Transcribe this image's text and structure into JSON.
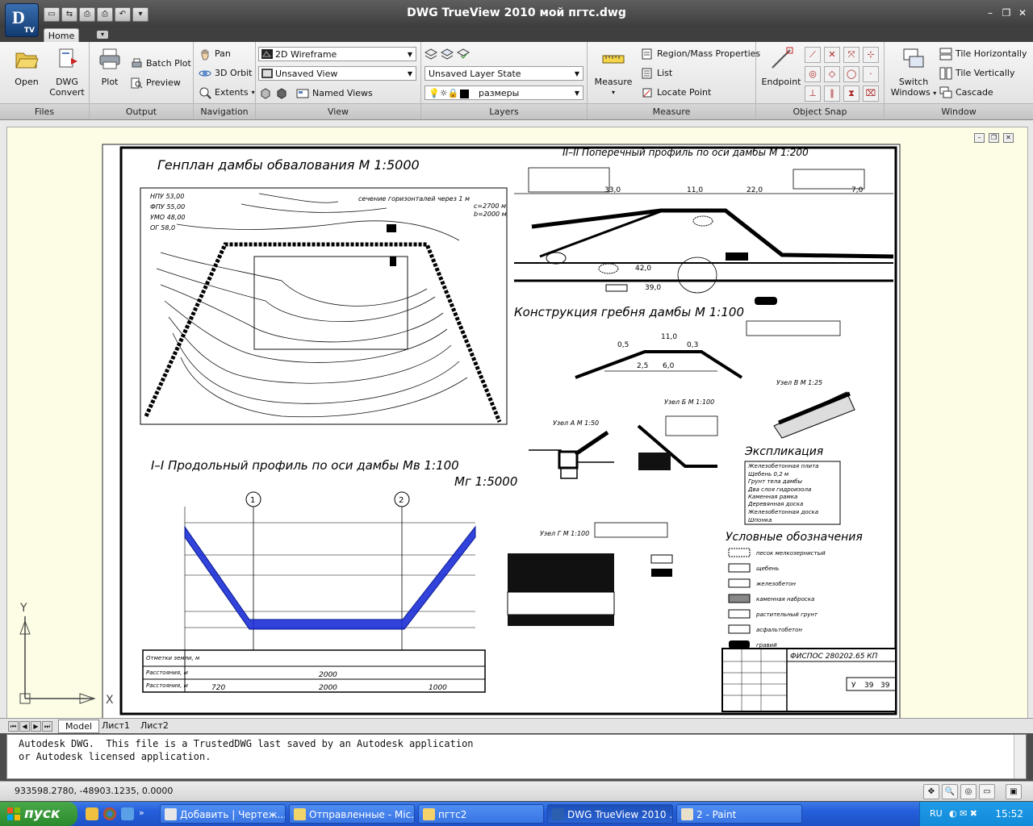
{
  "window": {
    "title": "DWG TrueView 2010    мой пгтс.dwg",
    "app_badge": "TV",
    "controls": [
      "minimize-icon",
      "restore-icon",
      "close-icon"
    ]
  },
  "ribbon": {
    "active_tab": "Home",
    "panels": {
      "files": {
        "title": "Files",
        "open": "Open",
        "dwg_convert_1": "DWG",
        "dwg_convert_2": "Convert"
      },
      "output": {
        "title": "Output",
        "plot": "Plot",
        "batch_plot": "Batch Plot",
        "preview": "Preview"
      },
      "navigation": {
        "title": "Navigation",
        "pan": "Pan",
        "orbit": "3D Orbit",
        "extents": "Extents"
      },
      "view": {
        "title": "View",
        "visual_style": "2D Wireframe",
        "saved_view": "Unsaved View",
        "named_views": "Named Views"
      },
      "layers": {
        "title": "Layers",
        "layer_state": "Unsaved Layer State",
        "current_layer": "размеры"
      },
      "measure": {
        "title": "Measure",
        "measure": "Measure",
        "region_mass": "Region/Mass Properties",
        "list": "List",
        "locate_point": "Locate Point"
      },
      "object_snap": {
        "title": "Object Snap",
        "endpoint": "Endpoint"
      },
      "window_panel": {
        "title": "Window",
        "switch_1": "Switch",
        "switch_2": "Windows",
        "tile_h": "Tile Horizontally",
        "tile_v": "Tile Vertically",
        "cascade": "Cascade"
      }
    }
  },
  "drawing": {
    "titles": {
      "genplan": "Генплан дамбы обвалования М 1:5000",
      "cross_profile": "II–II Поперечный профиль по оси дамбы М 1:200",
      "crest": "Конструкция гребня дамбы М 1:100",
      "long_profile_1": "I–I Продольный профиль по оси дамбы Мв 1:100",
      "long_profile_2": "Мг 1:5000",
      "explication": "Экспликация",
      "legend": "Условные обозначения",
      "node_a": "Узел А М 1:50",
      "node_b": "Узел Б М 1:100",
      "node_v": "Узел В М 1:25",
      "node_g": "Узел Г М 1:100"
    },
    "levels": [
      "НПУ 53,00",
      "ФПУ 55,00",
      "УМО 48,00",
      "ОГ 58,0"
    ],
    "contour_note_1": "сечение горизонталей через 1 м",
    "contour_note_2": "c=2700 м",
    "contour_note_3": "b=2000 м",
    "dims": {
      "d1": "33,0",
      "d2": "11,0",
      "d3": "22,0",
      "d4": "7,0",
      "d5": "42,0",
      "d6": "39,0",
      "d7": "11,0",
      "d8": "6,0",
      "d9": "2,5",
      "d10": "0,5",
      "d11": "0,3"
    },
    "explication_items": [
      "Железобетонная плита",
      "Щебень 0,2 м",
      "Грунт тела дамбы",
      "Два слоя гидроизола",
      "Каменная рамка",
      "Деревянная доска",
      "Железобетонная доска",
      "Шпонка"
    ],
    "legend_items": [
      "песок мелкозернистый",
      "щебень",
      "железобетон",
      "каменная наброска",
      "растительный грунт",
      "асфальтобетон",
      "гравий"
    ],
    "profile_rows": [
      "Отметки земли, м",
      "Расстояния, м",
      "Расстояния, м"
    ],
    "profile_dist": [
      "2000",
      "720",
      "2000",
      "1000"
    ],
    "stamp_code": "ФИСПОС 280202.65 КП",
    "stamp_sheet": "У",
    "stamp_num1": "39",
    "stamp_num2": "39",
    "markers": [
      "1",
      "2"
    ],
    "axis_y": "Y",
    "axis_x": "X"
  },
  "layout_tabs": [
    "Model",
    "Лист1",
    "Лист2"
  ],
  "command_line": {
    "line1": "Autodesk DWG.  This file is a TrustedDWG last saved by an Autodesk application",
    "line2": "or Autodesk licensed application."
  },
  "status": {
    "coords": "933598.2780, -48903.1235, 0.0000"
  },
  "taskbar": {
    "start": "пуск",
    "tasks": [
      "Добавить | Чертеж...",
      "Отправленные - Mic...",
      "пгтс2",
      "DWG TrueView 2010 ...",
      "2 - Paint"
    ],
    "lang": "RU",
    "clock": "15:52"
  },
  "colors": {
    "accent_blue": "#1f52c5",
    "profile_fill": "#1b2fd6",
    "viewport_bg": "#fdfde6"
  }
}
